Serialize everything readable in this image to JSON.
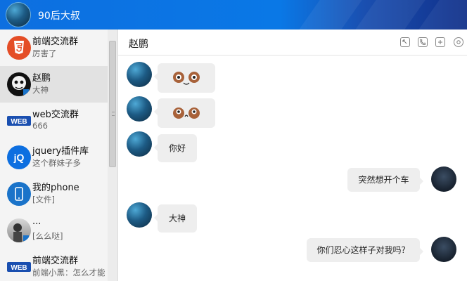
{
  "header": {
    "title": "90后大叔"
  },
  "conversations": [
    {
      "name": "前端交流群",
      "sub": "厉害了"
    },
    {
      "name": "赵鹏",
      "sub": "大神"
    },
    {
      "name": "web交流群",
      "sub": "666"
    },
    {
      "name": "jquery插件库",
      "sub": "这个群妹子多"
    },
    {
      "name": "我的phone",
      "sub": "[文件]"
    },
    {
      "name": "...",
      "sub": "[么么哒]"
    },
    {
      "name": "前端交流群",
      "sub": "前端小黑：怎么才能"
    }
  ],
  "chat": {
    "contact_name": "赵鹏",
    "messages": [
      {
        "side": "left",
        "text": ""
      },
      {
        "side": "left",
        "text": ""
      },
      {
        "side": "left",
        "text": "你好"
      },
      {
        "side": "right",
        "text": "突然想开个车"
      },
      {
        "side": "left",
        "text": "大神"
      },
      {
        "side": "right",
        "text": "你们忍心这样子对我吗？"
      }
    ]
  },
  "icons": {
    "header_actions": [
      "expand-icon",
      "phone-icon",
      "add-icon",
      "settings-icon"
    ]
  },
  "colors": {
    "topbar": "#0d6fe0",
    "bubble": "#eeeeee",
    "html5_badge": "#e44d26",
    "jquery_badge": "#0d6fe0"
  }
}
